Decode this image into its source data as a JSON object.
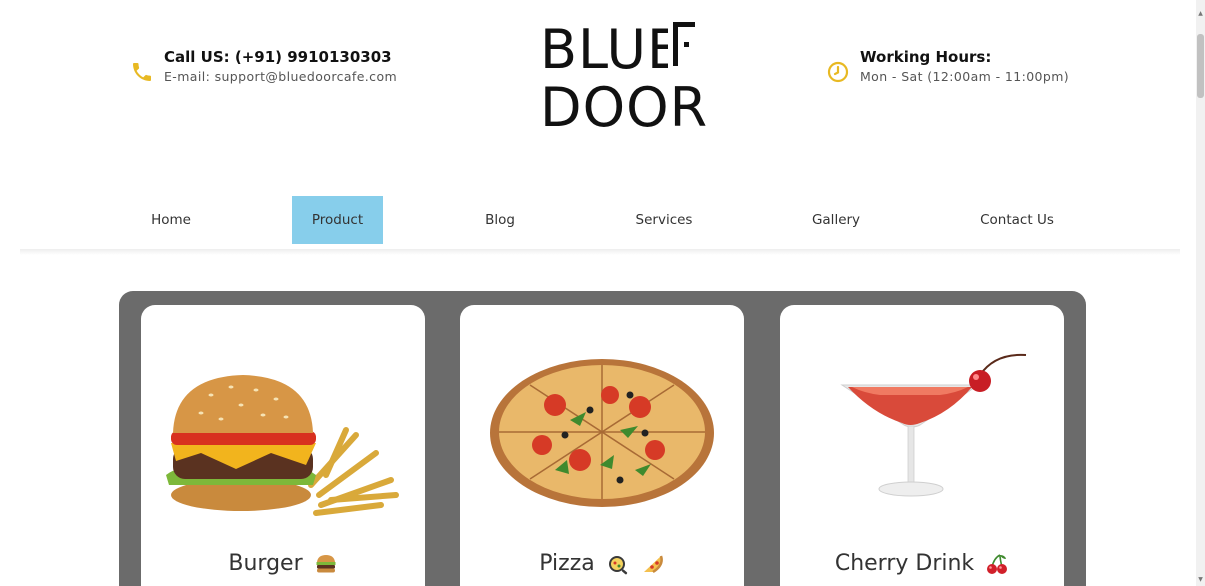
{
  "header": {
    "call_title": "Call US: (+91) 9910130303",
    "email_line": "E-mail: support@bluedoorcafe.com",
    "hours_title": "Working Hours:",
    "hours_line": "Mon - Sat (12:00am - 11:00pm)",
    "logo_line1": "BLUE",
    "logo_line2": "DOOR",
    "phone_icon": "phone-icon",
    "clock_icon": "clock-icon",
    "accent_color": "#e8b923"
  },
  "nav": {
    "items": [
      {
        "label": "Home",
        "active": false
      },
      {
        "label": "Product",
        "active": true
      },
      {
        "label": "Blog",
        "active": false
      },
      {
        "label": "Services",
        "active": false
      },
      {
        "label": "Gallery",
        "active": false
      },
      {
        "label": "Contact Us",
        "active": false
      }
    ],
    "active_color": "#87ceeb"
  },
  "products": [
    {
      "name": "Burger",
      "emoji": "burger-emoji",
      "image": "burger-image"
    },
    {
      "name": "Pizza",
      "emoji": "pizza-emoji",
      "image": "pizza-image"
    },
    {
      "name": "Cherry Drink",
      "emoji": "cherries-emoji",
      "image": "cherry-drink-image"
    }
  ],
  "panel_color": "#6b6b6b"
}
